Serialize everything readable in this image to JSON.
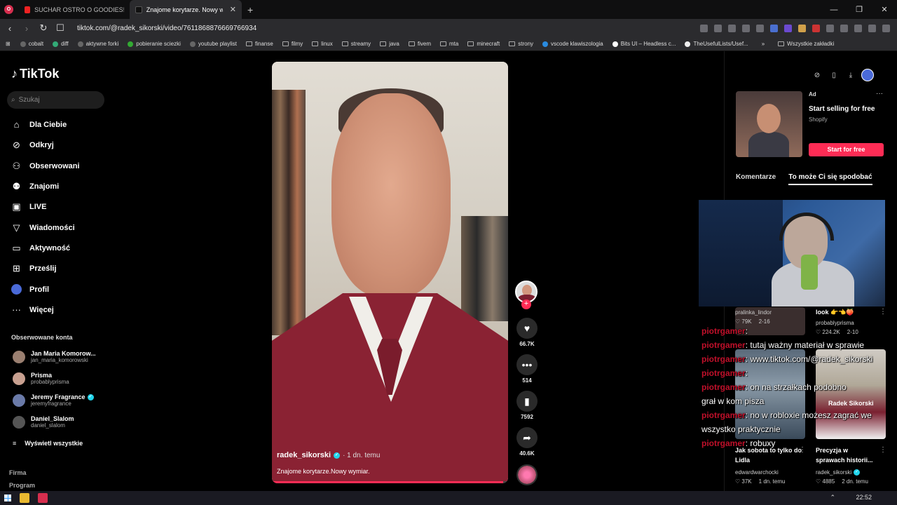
{
  "browser": {
    "tabs": [
      {
        "title": "SUCHAR OSTRO O GOODIES! ODPO",
        "active": false
      },
      {
        "title": "Znajome korytarze. Nowy wy",
        "active": true
      }
    ],
    "url": "tiktok.com/@radek_sikorski/video/7611868876669766934",
    "bookmarks": [
      "cobalt",
      "diff",
      "aktywne forki",
      "pobieranie sciezki",
      "youtube playlist",
      "finanse",
      "filmy",
      "linux",
      "streamy",
      "java",
      "fivem",
      "mta",
      "minecraft",
      "strony",
      "vscode klawiszologia",
      "Bits UI – Headless c...",
      "TheUsefulLists/Usef..."
    ],
    "all_bookmarks": "Wszystkie zakładki"
  },
  "sidebar": {
    "logo": "TikTok",
    "search_placeholder": "Szukaj",
    "nav": [
      {
        "label": "Dla Ciebie",
        "icon": "home-icon"
      },
      {
        "label": "Odkryj",
        "icon": "compass-icon"
      },
      {
        "label": "Obserwowani",
        "icon": "following-icon"
      },
      {
        "label": "Znajomi",
        "icon": "friends-icon"
      },
      {
        "label": "LIVE",
        "icon": "live-icon"
      },
      {
        "label": "Wiadomości",
        "icon": "messages-icon"
      },
      {
        "label": "Aktywność",
        "icon": "activity-icon"
      },
      {
        "label": "Prześlij",
        "icon": "upload-icon"
      },
      {
        "label": "Profil",
        "icon": "profile-avatar-icon"
      },
      {
        "label": "Więcej",
        "icon": "more-icon"
      }
    ],
    "followed_title": "Obserwowane konta",
    "accounts": [
      {
        "name": "Jan Maria Komorow...",
        "handle": "jan_maria_komorowski",
        "verified": false
      },
      {
        "name": "Prisma",
        "handle": "probablyprisma",
        "verified": false
      },
      {
        "name": "Jeremy Fragrance",
        "handle": "jeremyfragrance",
        "verified": true
      },
      {
        "name": "Daniel_Slalom",
        "handle": "daniel_slalom",
        "verified": false
      }
    ],
    "show_all": "Wyświetl wszystkie",
    "footer": [
      "Firma",
      "Program"
    ]
  },
  "video": {
    "author": "radek_sikorski",
    "age": "· 1 dn. temu",
    "description": "Znajome korytarze.Nowy wymiar.",
    "progress": 0.98
  },
  "actions": {
    "likes": "66.7K",
    "comments": "514",
    "saves": "7592",
    "shares": "40.6K"
  },
  "right": {
    "ad": {
      "label": "Ad",
      "title": "Start selling for free",
      "sub": "Shopify",
      "cta": "Start for free"
    },
    "tabs": [
      "Komentarze",
      "To może Ci się spodobać"
    ],
    "cards": [
      {
        "title": "",
        "author": "pralinka_lindor",
        "likes": "79K",
        "date": "2-16"
      },
      {
        "title": "look 👉👈🍑",
        "author": "probablyprisma",
        "likes": "224.2K",
        "date": "2-10"
      },
      {
        "title": "Jak sobota to tylko do Lidla",
        "author": "edwardwarchocki",
        "likes": "37K",
        "date": "1 dn. temu"
      },
      {
        "title": "Precyzja w sprawach historii...",
        "author": "radek_sikorski",
        "likes": "4885",
        "date": "2 dn. temu"
      }
    ],
    "card_overlay": "Radek Sikorski"
  },
  "chat": [
    {
      "user": "piotrgamer",
      "text": ":"
    },
    {
      "user": "piotrgamer",
      "text": ": tutaj ważny materiał w sprawie"
    },
    {
      "user": "piotrgamer",
      "text": ": www.tiktok.com/@radek_sikorski"
    },
    {
      "user": "piotrgamer",
      "text": ":"
    },
    {
      "user": "piotrgamer",
      "text": ": on na strzałkach podobno"
    },
    {
      "user": "",
      "text": "grał w kom pisza"
    },
    {
      "user": "piotrgamer",
      "text": ": no w robloxie możesz zagrać we"
    },
    {
      "user": "",
      "text": "wszystko praktycznie"
    },
    {
      "user": "piotrgamer",
      "text": ": robuxy"
    }
  ],
  "taskbar": {
    "time": "22:52"
  }
}
